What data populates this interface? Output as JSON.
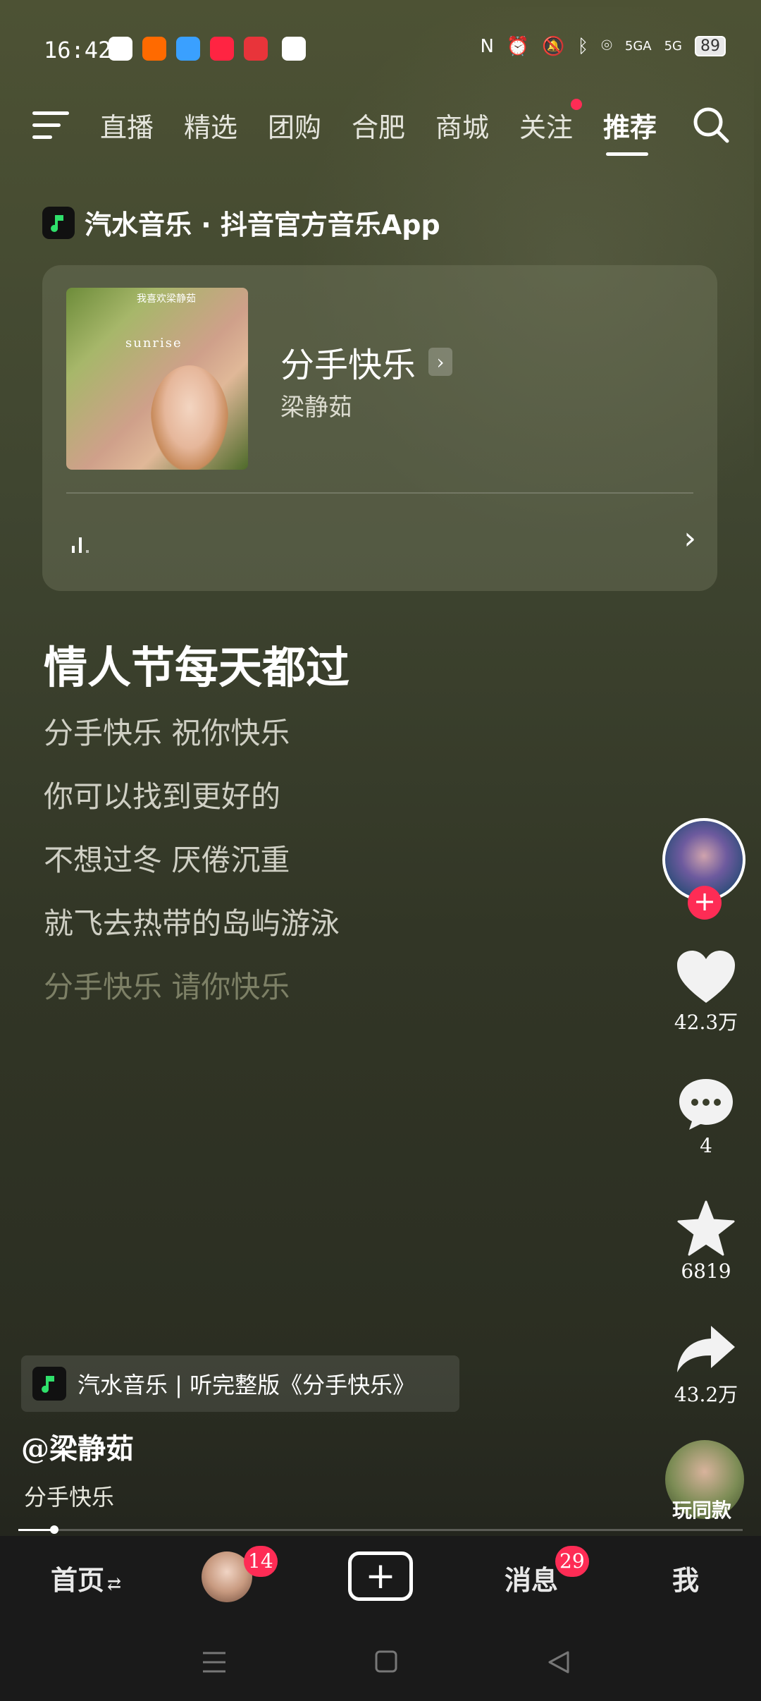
{
  "status_bar": {
    "time": "16:42",
    "battery": "89",
    "signal_1": "5GA",
    "signal_2": "5G"
  },
  "top_nav": {
    "tabs": [
      "直播",
      "精选",
      "团购",
      "合肥",
      "商城",
      "关注",
      "推荐"
    ],
    "active_tab_index": 6
  },
  "music_app": {
    "header": "汽水音乐 · 抖音官方音乐App",
    "song_title": "分手快乐",
    "artist": "梁静茹",
    "cover_text": "我喜欢梁静茹",
    "cover_word": "sunrise"
  },
  "lyrics": {
    "headline": "情人节每天都过",
    "lines": [
      "分手快乐 祝你快乐",
      "你可以找到更好的",
      "不想过冬 厌倦沉重",
      "就飞去热带的岛屿游泳",
      "分手快乐 请你快乐"
    ]
  },
  "actions": {
    "likes": "42.3万",
    "comments": "4",
    "favorites": "6819",
    "shares": "43.2万",
    "follow": "+",
    "play_same": "玩同款"
  },
  "bottom_info": {
    "promo": "汽水音乐 | 听完整版《分手快乐》",
    "author": "@梁静茹",
    "description": "分手快乐"
  },
  "playback": {
    "progress": 0.05
  },
  "bottom_nav": {
    "home": "首页",
    "home_suffix": "⇄",
    "friends_badge": "14",
    "create": "+",
    "messages": "消息",
    "messages_badge": "29",
    "me": "我"
  },
  "colors": {
    "accent": "#fe2c55",
    "background": "#3a3e2b",
    "nav_bar": "#1a1a1a"
  }
}
